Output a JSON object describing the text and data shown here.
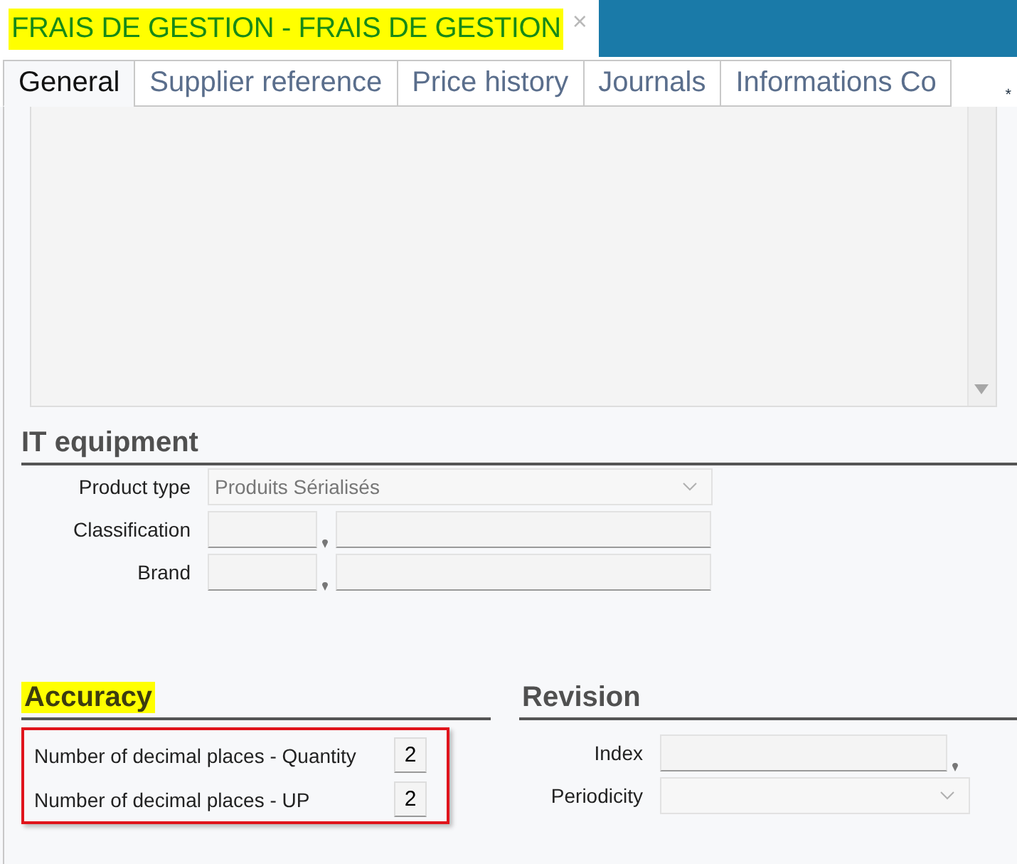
{
  "window": {
    "title": "FRAIS DE GESTION - FRAIS DE GESTION",
    "title_highlighted": true,
    "close": "×"
  },
  "tabs": [
    {
      "label": "General",
      "selected": true
    },
    {
      "label": "Supplier reference",
      "selected": false
    },
    {
      "label": "Price history",
      "selected": false
    },
    {
      "label": "Journals",
      "selected": false
    },
    {
      "label": "Informations Co",
      "selected": false
    }
  ],
  "required_mark": "*",
  "it_equipment": {
    "heading": "IT equipment",
    "product_type": {
      "label": "Product type",
      "value": "Produits Sérialisés",
      "disabled": true
    },
    "lookups": [
      {
        "label": "Classification"
      },
      {
        "label": "Brand"
      }
    ]
  },
  "accuracy": {
    "heading": "Accuracy",
    "highlighted": true,
    "outlined": true,
    "rows": [
      {
        "label": "Number of decimal places - Quantity",
        "value": "2"
      },
      {
        "label": "Number of decimal places - UP",
        "value": "2"
      }
    ]
  },
  "revision": {
    "heading": "Revision",
    "index": {
      "label": "Index"
    },
    "periodicity": {
      "label": "Periodicity"
    }
  }
}
